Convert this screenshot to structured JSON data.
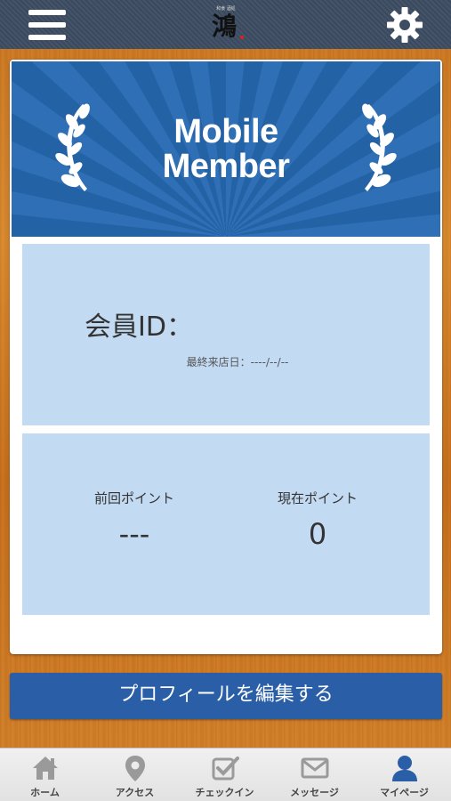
{
  "header": {
    "menu_icon": "hamburger-menu-icon",
    "settings_icon": "gear-icon",
    "logo": {
      "small_text": "和食 酒処",
      "main_text": "鴻"
    }
  },
  "banner": {
    "title_line1": "Mobile",
    "title_line2": "Member",
    "decoration": "laurel-icon",
    "colors": {
      "primary": "#2e6fb5",
      "secondary": "#2462a6"
    }
  },
  "member": {
    "id_label": "会員ID：",
    "last_visit": "最終来店日：----/--/--"
  },
  "points": {
    "previous_label": "前回ポイント",
    "previous_value": "---",
    "current_label": "現在ポイント",
    "current_value": "0"
  },
  "actions": {
    "edit_profile_label": "プロフィールを編集する"
  },
  "tabbar": {
    "tabs": [
      {
        "label": "ホーム",
        "icon": "home-icon"
      },
      {
        "label": "アクセス",
        "icon": "map-pin-icon"
      },
      {
        "label": "チェックイン",
        "icon": "checkin-icon"
      },
      {
        "label": "メッセージ",
        "icon": "envelope-icon"
      },
      {
        "label": "マイページ",
        "icon": "user-icon"
      }
    ],
    "active_tab": "マイページ",
    "colors": {
      "inactive_icon": "#9a9a9a",
      "active_icon": "#2a5fa8"
    }
  }
}
